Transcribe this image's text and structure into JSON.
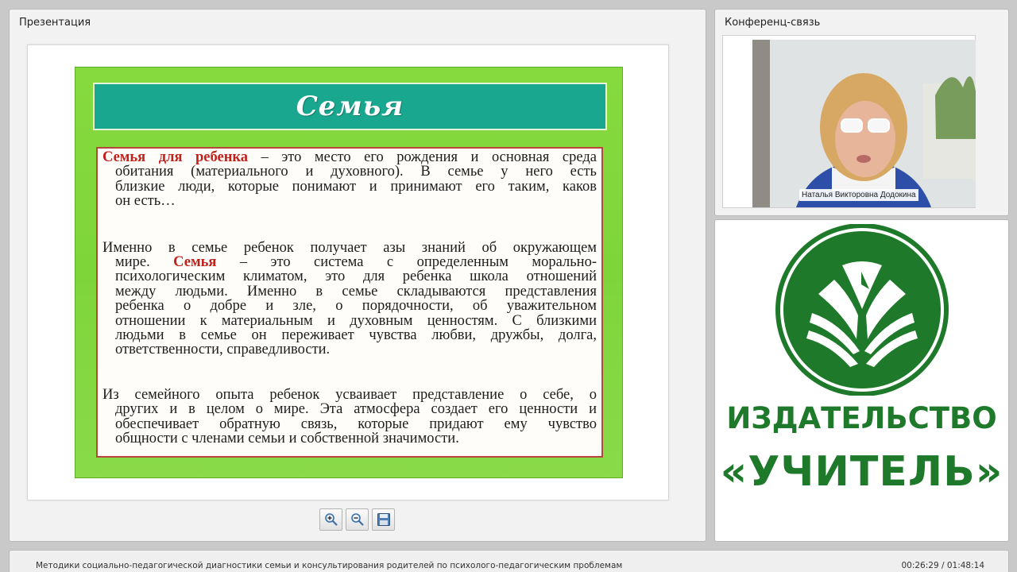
{
  "presentation_panel": {
    "title": "Презентация"
  },
  "conference_panel": {
    "title": "Конференц-связь",
    "speaker_name": "Наталья Викторовна Додокина"
  },
  "slide": {
    "title": "Семья",
    "paragraphs": [
      {
        "lines": [
          {
            "highlight": "Семья для ребенка",
            "text": " – это место его рождения и основная среда"
          },
          {
            "text": "обитания (материального и духовного). В семье у него есть",
            "indent": true
          },
          {
            "text": "близкие люди, которые понимают и принимают его таким, каков",
            "indent": true
          },
          {
            "text": "он есть…",
            "indent": true
          }
        ]
      },
      {
        "lines": [
          {
            "text": "Именно в семье ребенок получает азы знаний об окружающем"
          },
          {
            "text": "мире. ",
            "highlight": "Семья",
            "text2": " – это система с определенным морально-",
            "indent": true
          },
          {
            "text": "психологическим климатом, это для ребенка школа отношений",
            "indent": true
          },
          {
            "text": "между людьми. Именно в семье складываются представления",
            "indent": true
          },
          {
            "text": "ребенка о добре и зле, о порядочности, об уважительном",
            "indent": true
          },
          {
            "text": "отношении к материальным и духовным ценностям. С близкими",
            "indent": true
          },
          {
            "text": "людьми в семье он переживает чувства любви, дружбы, долга,",
            "indent": true
          },
          {
            "text": "ответственности, справедливости.",
            "indent": true
          }
        ]
      },
      {
        "lines": [
          {
            "text": "Из семейного опыта ребенок усваивает представление о себе, о"
          },
          {
            "text": "других и в целом о мире. Эта атмосфера создает его ценности и",
            "indent": true
          },
          {
            "text": "обеспечивает обратную связь, которые придают ему чувство",
            "indent": true
          },
          {
            "text": "общности с членами семьи и собственной значимости.",
            "indent": true
          }
        ]
      }
    ]
  },
  "toolbar": {
    "zoom_in_icon": "zoom-in-icon",
    "zoom_out_icon": "zoom-out-icon",
    "save_icon": "floppy-disk-icon"
  },
  "publisher": {
    "line1": "ИЗДАТЕЛЬСТВО",
    "line2": "«УЧИТЕЛЬ»",
    "color": "#1e7a2a"
  },
  "footer": {
    "course_title": "Методики социально-педагогической диагностики семьи и консультирования родителей по психолого-педагогическим проблемам",
    "time": "00:26:29 / 01:48:14"
  }
}
